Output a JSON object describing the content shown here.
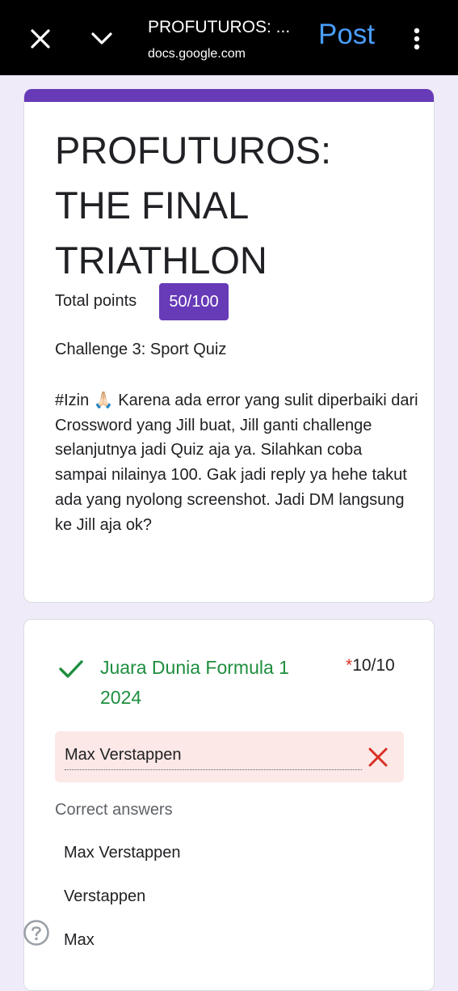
{
  "topbar": {
    "close_icon": "close-icon",
    "chevron_icon": "chevron-down-icon",
    "title": "PROFUTUROS: ...",
    "url": "docs.google.com",
    "post_label": "Post",
    "more_icon": "more-vert-icon",
    "post_color": "#4a9eff"
  },
  "form": {
    "accent_color": "#673ab7",
    "title_lines": [
      "PROFUTUROS:",
      "THE FINAL",
      "TRIATHLON"
    ],
    "total_points_label": "Total points",
    "score": "50/100",
    "challenge": "Challenge 3: Sport Quiz",
    "description": "#Izin 🙏🏻 Karena ada error yang sulit diperbaiki dari Crossword yang Jill buat, Jill ganti challenge selanjutnya jadi Quiz aja ya. Silahkan coba sampai nilainya 100. Gak jadi reply ya hehe takut ada yang nyolong screenshot. Jadi DM langsung ke Jill aja ok?"
  },
  "question": {
    "status_icon": "check-icon",
    "title": "Juara Dunia Formula 1 2024",
    "required_mark": "*",
    "score": "10/10",
    "answer": "Max Verstappen",
    "answer_status_icon": "wrong-x-icon",
    "correct_heading": "Correct answers",
    "correct_answers": [
      "Max Verstappen",
      "Verstappen",
      "Max"
    ],
    "correct_color": "#1e8e3e",
    "wrong_color": "#d93025"
  },
  "help_icon": "help-icon"
}
